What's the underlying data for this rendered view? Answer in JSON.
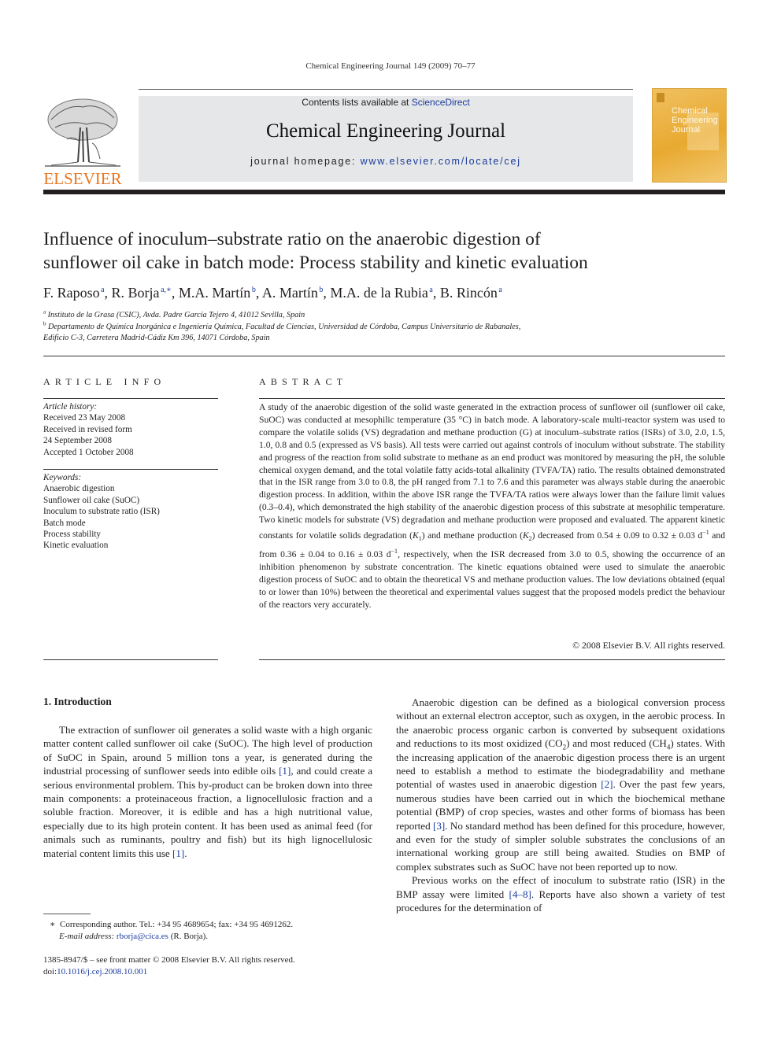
{
  "header": {
    "running_head": "Chemical Engineering Journal 149 (2009) 70–77",
    "publisher_logo": "ELSEVIER",
    "contents_prefix": "Contents lists available at ",
    "contents_link": "ScienceDirect",
    "journal_title": "Chemical Engineering Journal",
    "homepage_prefix": "journal homepage: ",
    "homepage_link": "www.elsevier.com/locate/cej",
    "cover_title_lines": [
      "Chemical",
      "Engineering",
      "Journal"
    ],
    "colors": {
      "brand_orange": "#e87722",
      "link_blue": "#1a3b9e",
      "banner_gray": "#e6e7e8",
      "cover_gold": "#e8a930"
    }
  },
  "article": {
    "title_line1": "Influence of inoculum–substrate ratio on the anaerobic digestion of",
    "title_line2": "sunflower oil cake in batch mode: Process stability and kinetic evaluation",
    "authors": [
      {
        "name": "F. Raposo",
        "sup": "a"
      },
      {
        "name": "R. Borja",
        "sup": "a,∗"
      },
      {
        "name": "M.A. Martín",
        "sup": "b"
      },
      {
        "name": "A. Martín",
        "sup": "b"
      },
      {
        "name": "M.A. de la Rubia",
        "sup": "a"
      },
      {
        "name": "B. Rincón",
        "sup": "a"
      }
    ],
    "affiliations": [
      {
        "mark": "a",
        "text": "Instituto de la Grasa (CSIC), Avda. Padre García Tejero 4, 41012 Sevilla, Spain"
      },
      {
        "mark": "b",
        "text": "Departamento de Química Inorgánica e Ingeniería Química, Facultad de Ciencias, Universidad de Córdoba, Campus Universitario de Rabanales,",
        "text2": "Edificio C-3, Carretera Madrid-Cádiz Km 396, 14071 Córdoba, Spain"
      }
    ]
  },
  "article_info": {
    "heading": "ARTICLE INFO",
    "history_label": "Article history:",
    "history": [
      "Received 23 May 2008",
      "Received in revised form",
      "24 September 2008",
      "Accepted 1 October 2008"
    ],
    "keywords_label": "Keywords:",
    "keywords": [
      "Anaerobic digestion",
      "Sunflower oil cake (SuOC)",
      "Inoculum to substrate ratio (ISR)",
      "Batch mode",
      "Process stability",
      "Kinetic evaluation"
    ]
  },
  "abstract": {
    "heading": "ABSTRACT",
    "p1": "A study of the anaerobic digestion of the solid waste generated in the extraction process of sunflower oil (sunflower oil cake, SuOC) was conducted at mesophilic temperature (35 °C) in batch mode. A laboratory-scale multi-reactor system was used to compare the volatile solids (VS) degradation and methane production (G) at inoculum–substrate ratios (ISRs) of 3.0, 2.0, 1.5, 1.0, 0.8 and 0.5 (expressed as VS basis). All tests were carried out against controls of inoculum without substrate. The stability and progress of the reaction from solid substrate to methane as an end product was monitored by measuring the pH, the soluble chemical oxygen demand, and the total volatile fatty acids-total alkalinity (TVFA/TA) ratio. The results obtained demonstrated that in the ISR range from 3.0 to 0.8, the pH ranged from 7.1 to 7.6 and this parameter was always stable during the anaerobic digestion process. In addition, within the above ISR range the TVFA/TA ratios were always lower than the failure limit values (0.3–0.4), which demonstrated the high stability of the anaerobic digestion process of this substrate at mesophilic temperature. Two kinetic models for substrate (VS) degradation and methane production were proposed and evaluated. The apparent kinetic constants for volatile solids degradation (",
    "k1": "K",
    "k1_sub": "1",
    "p2": ") and methane production (",
    "k2": "K",
    "k2_sub": "2",
    "p3": ") decreased from 0.54 ± 0.09 to 0.32 ± 0.03 d",
    "unit_sup": "−1",
    "p4": " and from 0.36 ± 0.04 to 0.16 ± 0.03 d",
    "p5": ", respectively, when the ISR decreased from 3.0 to 0.5, showing the occurrence of an inhibition phenomenon by substrate concentration. The kinetic equations obtained were used to simulate the anaerobic digestion process of SuOC and to obtain the theoretical VS and methane production values. The low deviations obtained (equal to or lower than 10%) between the theoretical and experimental values suggest that the proposed models predict the behaviour of the reactors very accurately.",
    "copyright": "© 2008 Elsevier B.V. All rights reserved."
  },
  "body": {
    "section1_heading": "1.  Introduction",
    "col1_p1_a": "The extraction of sunflower oil generates a solid waste with a high organic matter content called sunflower oil cake (SuOC). The high level of production of SuOC in Spain, around 5 million tons a year, is generated during the industrial processing of sunflower seeds into edible oils ",
    "ref1": "[1]",
    "col1_p1_b": ", and could create a serious environmental problem. This by-product can be broken down into three main components: a proteinaceous fraction, a lignocellulosic fraction and a soluble fraction. Moreover, it is edible and has a high nutritional value, especially due to its high protein content. It has been used as animal feed (for animals such as ruminants, poultry and fish) but its high lignocellulosic material content limits this use ",
    "col1_p1_c": ".",
    "col2_p1_a": "Anaerobic digestion can be defined as a biological conversion process without an external electron acceptor, such as oxygen, in the aerobic process. In the anaerobic process organic carbon is converted by subsequent oxidations and reductions to its most oxidized (CO",
    "sub2": "2",
    "col2_p1_b": ") and most reduced (CH",
    "sub4": "4",
    "col2_p1_c": ") states. With the increasing application of the anaerobic digestion process there is an urgent need to establish a method to estimate the biodegradability and methane potential of wastes used in anaerobic digestion ",
    "ref2": "[2]",
    "col2_p1_d": ". Over the past few years, numerous studies have been carried out in which the biochemical methane potential (BMP) of crop species, wastes and other forms of biomass has been reported ",
    "ref3": "[3]",
    "col2_p1_e": ". No standard method has been defined for this procedure, however, and even for the study of simpler soluble substrates the conclusions of an international working group are still being awaited. Studies on BMP of complex substrates such as SuOC have not been reported up to now.",
    "col2_p2_a": "Previous works on the effect of inoculum to substrate ratio (ISR) in the BMP assay were limited ",
    "ref4_8": "[4–8]",
    "col2_p2_b": ". Reports have also shown a variety of test procedures for the determination of"
  },
  "footer": {
    "corresponding_mark": "∗",
    "corresponding": "Corresponding author. Tel.: +34 95 4689654; fax: +34 95 4691262.",
    "email_label": "E-mail address: ",
    "email": "rborja@cica.es",
    "email_suffix": " (R. Borja).",
    "front_matter": "1385-8947/$ – see front matter © 2008 Elsevier B.V. All rights reserved.",
    "doi_label": "doi:",
    "doi": "10.1016/j.cej.2008.10.001"
  }
}
